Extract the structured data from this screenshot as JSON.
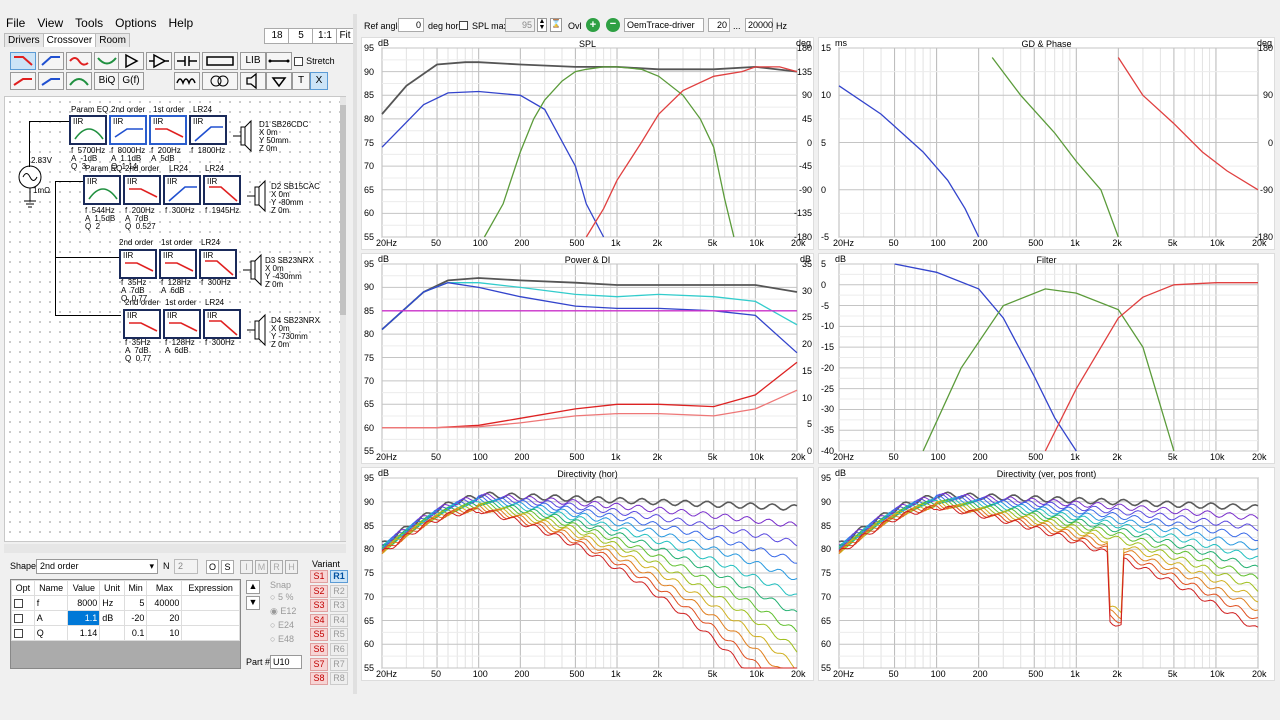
{
  "menu": [
    "File",
    "View",
    "Tools",
    "Options",
    "Help"
  ],
  "tabs": [
    "Drivers",
    "Crossover",
    "Room"
  ],
  "topright_buttons": [
    "18",
    "5",
    "1:1",
    "Fit"
  ],
  "tool_labels": {
    "lib": "LIB",
    "biq": "BiQ",
    "gf": "G(f)",
    "stretch": "Stretch",
    "t": "T",
    "x": "X"
  },
  "schematic": {
    "source": "2.83V",
    "source_r": "1mΩ",
    "rows": [
      {
        "headers": [
          "Param EQ",
          "2nd order",
          "1st order",
          "LR24"
        ],
        "blocks": [
          {
            "t": "IIR",
            "params": "f  5700Hz\nA  -1dB\nQ  3"
          },
          {
            "t": "IIR",
            "params": "f  8000Hz\nA  1.1dB\nQ  1.14"
          },
          {
            "t": "IIR",
            "params": "f  200Hz\nA  5dB"
          },
          {
            "t": "IIR",
            "params": "f  1800Hz"
          }
        ],
        "driver": "D1 SB26CDC\nX 0m\nY 50mm\nZ 0m"
      },
      {
        "headers": [
          "Param EQ",
          "2nd order",
          "LR24",
          "LR24"
        ],
        "blocks": [
          {
            "t": "IIR",
            "params": "f  544Hz\nA  1.5dB\nQ  2"
          },
          {
            "t": "IIR",
            "params": "f  200Hz\nA  7dB\nQ  0.527"
          },
          {
            "t": "IIR",
            "params": "f  300Hz"
          },
          {
            "t": "IIR",
            "params": "f  1945Hz"
          }
        ],
        "driver": "D2 SB15CAC\nX 0m\nY -80mm\nZ 0m"
      },
      {
        "headers": [
          "2nd order",
          "1st order",
          "LR24"
        ],
        "blocks": [
          {
            "t": "IIR",
            "params": "f  35Hz\nA  7dB\nQ  0.77"
          },
          {
            "t": "IIR",
            "params": "f  128Hz\nA  6dB"
          },
          {
            "t": "IIR",
            "params": "f  300Hz"
          }
        ],
        "driver": "D3 SB23NRX\nX 0m\nY -430mm\nZ 0m"
      },
      {
        "headers": [
          "2nd order",
          "1st order",
          "LR24"
        ],
        "blocks": [
          {
            "t": "IIR",
            "params": "f  35Hz\nA  7dB\nQ  0.77"
          },
          {
            "t": "IIR",
            "params": "f  128Hz\nA  6dB"
          },
          {
            "t": "IIR",
            "params": "f  300Hz"
          }
        ],
        "driver": "D4 SB23NRX\nX 0m\nY -730mm\nZ 0m"
      }
    ]
  },
  "shape": {
    "label": "Shape",
    "value": "2nd order",
    "n_label": "N",
    "n_value": "2",
    "buttons": [
      "O",
      "S",
      "I",
      "M",
      "R",
      "H"
    ]
  },
  "params": {
    "headers": [
      "Opt",
      "Name",
      "Value",
      "Unit",
      "Min",
      "Max",
      "Expression"
    ],
    "rows": [
      {
        "name": "f",
        "value": "8000",
        "unit": "Hz",
        "min": "5",
        "max": "40000"
      },
      {
        "name": "A",
        "value": "1.1",
        "unit": "dB",
        "min": "-20",
        "max": "20"
      },
      {
        "name": "Q",
        "value": "1.14",
        "unit": "",
        "min": "0.1",
        "max": "10"
      }
    ]
  },
  "snap": {
    "label": "Snap",
    "options": [
      "5 %",
      "E12",
      "E24",
      "E48"
    ],
    "selected": "E12"
  },
  "part": {
    "label": "Part #",
    "value": "U10"
  },
  "variant": {
    "label": "Variant",
    "s": [
      "S1",
      "S2",
      "S3",
      "S4",
      "S5",
      "S6",
      "S7",
      "S8"
    ],
    "r": [
      "R1",
      "R2",
      "R3",
      "R4",
      "R5",
      "R6",
      "R7",
      "R8"
    ]
  },
  "topbar": {
    "ref_angle_label": "Ref angle",
    "ref_angle": "0",
    "deg_hor": "deg hor",
    "splmax_label": "SPL max",
    "splmax": "95",
    "ovl_label": "Ovl",
    "trace": "OemTrace-driver",
    "f_lo": "20",
    "dots": "...",
    "f_hi": "20000",
    "hz": "Hz"
  },
  "colors": {
    "accent": "#0078d7",
    "grid": "#d0d0d0"
  },
  "chart_data": [
    {
      "type": "line",
      "title": "SPL",
      "ylabel": "dB",
      "y2label": "deg",
      "ylim": [
        55,
        95
      ],
      "y2lim": [
        -180,
        180
      ],
      "xscale": "log",
      "xlim": [
        20,
        20000
      ],
      "xticks": [
        "20Hz",
        "50",
        "100",
        "200",
        "500",
        "1k",
        "2k",
        "5k",
        "10k",
        "20k"
      ],
      "yticks": [
        "95",
        "90",
        "85",
        "80",
        "75",
        "70",
        "65",
        "60",
        "55"
      ],
      "y2ticks": [
        "180",
        "135",
        "90",
        "45",
        "0",
        "-45",
        "-90",
        "-135",
        "-180"
      ],
      "series": [
        {
          "color": "#555555",
          "x": [
            20,
            30,
            50,
            80,
            100,
            200,
            500,
            1000,
            2000,
            5000,
            10000,
            20000
          ],
          "y": [
            81,
            87,
            91.5,
            92,
            92,
            91.5,
            91,
            91,
            90.5,
            90.5,
            91,
            90
          ]
        },
        {
          "color": "#3344cc",
          "x": [
            20,
            40,
            60,
            100,
            200,
            300,
            500,
            600,
            800
          ],
          "y": [
            74,
            83,
            85.5,
            85.8,
            85,
            82,
            70,
            62,
            55
          ]
        },
        {
          "color": "#5b9b3a",
          "x": [
            110,
            150,
            200,
            250,
            300,
            400,
            500,
            600,
            800,
            1000,
            1500,
            2000,
            3000,
            4000,
            5000,
            6000,
            7000
          ],
          "y": [
            55,
            62,
            73,
            80,
            84,
            88,
            90,
            90.5,
            91,
            91,
            90.5,
            89,
            85,
            80,
            74,
            63,
            55
          ]
        },
        {
          "color": "#e04040",
          "x": [
            600,
            800,
            1000,
            1500,
            2000,
            3000,
            5000,
            8000,
            10000,
            15000,
            20000
          ],
          "y": [
            55,
            61,
            67,
            75,
            81,
            86,
            89,
            90,
            91,
            91,
            90
          ]
        }
      ]
    },
    {
      "type": "line",
      "title": "GD & Phase",
      "ylabel": "ms",
      "y2label": "deg",
      "ylim": [
        -5,
        15
      ],
      "y2lim": [
        -180,
        180
      ],
      "xscale": "log",
      "xlim": [
        20,
        20000
      ],
      "xticks": [
        "20Hz",
        "50",
        "100",
        "200",
        "500",
        "1k",
        "2k",
        "5k",
        "10k",
        "20k"
      ],
      "yticks": [
        "15",
        "10",
        "5",
        "0",
        "-5"
      ],
      "y2ticks": [
        "180",
        "90",
        "0",
        "-90",
        "-180"
      ],
      "series": [
        {
          "color": "#3344cc",
          "x": [
            20,
            40,
            80,
            120,
            160,
            200
          ],
          "y": [
            11,
            8,
            4,
            1,
            -2,
            -5
          ]
        },
        {
          "color": "#5b9b3a",
          "x": [
            250,
            400,
            700,
            1000,
            1500,
            2000
          ],
          "y": [
            14,
            10,
            6,
            3,
            0,
            -5
          ]
        },
        {
          "color": "#e04040",
          "x": [
            2000,
            3000,
            5000,
            8000,
            12000,
            20000
          ],
          "y": [
            14,
            10,
            7,
            4,
            2,
            0
          ]
        }
      ]
    },
    {
      "type": "line",
      "title": "Power & DI",
      "ylabel": "dB",
      "y2label": "dB",
      "ylim": [
        55,
        95
      ],
      "y2lim": [
        0,
        35
      ],
      "xscale": "log",
      "xlim": [
        20,
        20000
      ],
      "xticks": [
        "20Hz",
        "50",
        "100",
        "200",
        "500",
        "1k",
        "2k",
        "5k",
        "10k",
        "20k"
      ],
      "yticks": [
        "95",
        "90",
        "85",
        "80",
        "75",
        "70",
        "65",
        "60",
        "55"
      ],
      "y2ticks": [
        "35",
        "30",
        "25",
        "20",
        "15",
        "10",
        "5",
        "0"
      ],
      "series": [
        {
          "color": "#555555",
          "x": [
            20,
            40,
            60,
            100,
            200,
            500,
            1000,
            2000,
            5000,
            10000,
            20000
          ],
          "y": [
            81,
            89,
            91.5,
            92,
            91.5,
            91,
            90.5,
            90.5,
            90.5,
            90.5,
            89
          ]
        },
        {
          "color": "#33cccc",
          "x": [
            20,
            40,
            60,
            100,
            200,
            500,
            1000,
            2000,
            5000,
            10000,
            20000
          ],
          "y": [
            81,
            89,
            91,
            91,
            90,
            88.5,
            88,
            88.5,
            88,
            87,
            82
          ]
        },
        {
          "color": "#3344cc",
          "x": [
            20,
            40,
            60,
            100,
            200,
            500,
            1000,
            2000,
            5000,
            10000,
            20000
          ],
          "y": [
            81,
            89,
            91,
            90,
            88,
            86,
            85.5,
            85.5,
            85,
            84,
            76
          ]
        },
        {
          "color": "#cc33cc",
          "x": [
            20,
            20000
          ],
          "y": [
            85,
            85
          ]
        },
        {
          "color": "#dd2222",
          "x": [
            20,
            50,
            100,
            200,
            500,
            1000,
            2000,
            5000,
            10000,
            20000
          ],
          "y": [
            60,
            60,
            60.5,
            62,
            64,
            65,
            65,
            64.5,
            67,
            74
          ]
        },
        {
          "color": "#ee7777",
          "x": [
            20,
            50,
            100,
            200,
            500,
            1000,
            2000,
            5000,
            10000,
            20000
          ],
          "y": [
            60,
            60,
            60.2,
            61,
            62.5,
            63,
            63,
            62.5,
            64,
            68
          ]
        }
      ]
    },
    {
      "type": "line",
      "title": "Filter",
      "ylabel": "dB",
      "ylim": [
        -40,
        5
      ],
      "xscale": "log",
      "xlim": [
        20,
        20000
      ],
      "xticks": [
        "20Hz",
        "50",
        "100",
        "200",
        "500",
        "1k",
        "2k",
        "5k",
        "10k",
        "20k"
      ],
      "yticks": [
        "5",
        "0",
        "-5",
        "-10",
        "-15",
        "-20",
        "-25",
        "-30",
        "-35",
        "-40"
      ],
      "series": [
        {
          "color": "#3344cc",
          "x": [
            50,
            100,
            200,
            300,
            500,
            700,
            1000
          ],
          "y": [
            5,
            3,
            -1,
            -8,
            -22,
            -32,
            -40
          ]
        },
        {
          "color": "#5b9b3a",
          "x": [
            80,
            150,
            300,
            600,
            1000,
            2000,
            3000,
            5000
          ],
          "y": [
            -40,
            -20,
            -5,
            -1,
            -2,
            -6,
            -15,
            -40
          ]
        },
        {
          "color": "#e04040",
          "x": [
            600,
            1000,
            2000,
            3000,
            5000,
            10000,
            20000
          ],
          "y": [
            -40,
            -25,
            -8,
            -3,
            0,
            0.5,
            0.5
          ]
        }
      ]
    },
    {
      "type": "line",
      "title": "Directivity (hor)",
      "ylabel": "dB",
      "ylim": [
        55,
        95
      ],
      "xscale": "log",
      "xlim": [
        20,
        20000
      ],
      "xticks": [
        "20Hz",
        "50",
        "100",
        "200",
        "500",
        "1k",
        "2k",
        "5k",
        "10k",
        "20k"
      ],
      "yticks": [
        "95",
        "90",
        "85",
        "80",
        "75",
        "70",
        "65",
        "60",
        "55"
      ]
    },
    {
      "type": "line",
      "title": "Directivity (ver, pos front)",
      "ylabel": "dB",
      "ylim": [
        55,
        95
      ],
      "xscale": "log",
      "xlim": [
        20,
        20000
      ],
      "xticks": [
        "20Hz",
        "50",
        "100",
        "200",
        "500",
        "1k",
        "2k",
        "5k",
        "10k",
        "20k"
      ],
      "yticks": [
        "95",
        "90",
        "85",
        "80",
        "75",
        "70",
        "65",
        "60",
        "55"
      ]
    }
  ]
}
